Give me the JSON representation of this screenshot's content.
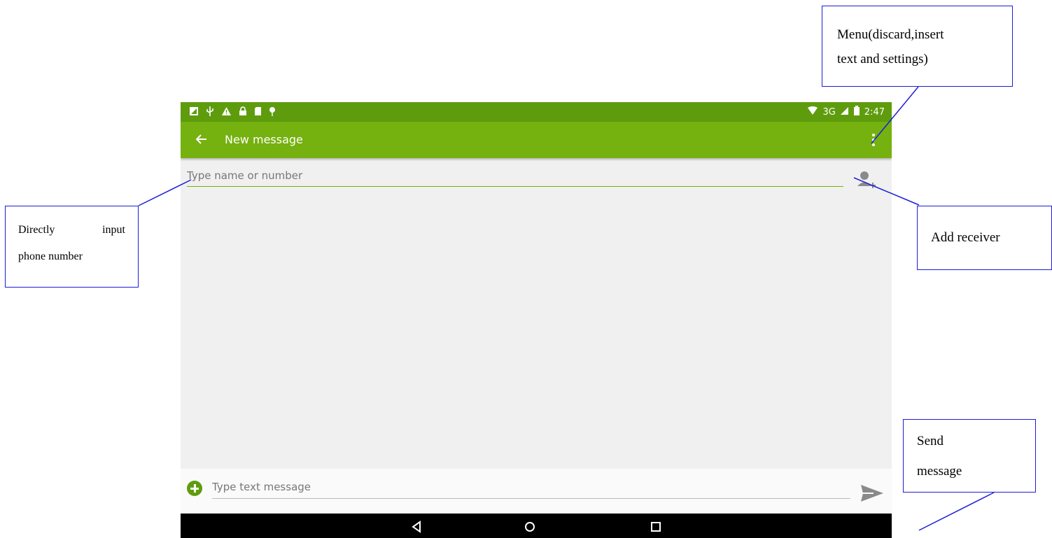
{
  "status_bar": {
    "network": "3G",
    "time": "2:47"
  },
  "app_bar": {
    "back_icon": "arrow-left-icon",
    "title": "New message",
    "menu_icon": "more-vert-icon"
  },
  "recipient": {
    "placeholder": "Type name or number",
    "add_contact_icon": "add-contact-icon"
  },
  "compose": {
    "attach_icon": "plus-circle-icon",
    "placeholder": "Type text message",
    "send_icon": "send-icon"
  },
  "nav_bar": {
    "icons": [
      "back-triangle-icon",
      "home-circle-icon",
      "recents-square-icon"
    ]
  },
  "annotations": {
    "menu_line1": "Menu(discard,insert",
    "menu_line2": "text and settings)",
    "direct_input_word1": "Directly",
    "direct_input_word2": "input",
    "direct_input_line2": "phone number",
    "add_receiver": "Add receiver",
    "send_line1": "Send",
    "send_line2": "message"
  },
  "colors": {
    "status_bar": "#5e9c0e",
    "app_bar": "#75b10f",
    "callout_border": "#1d1dd8"
  }
}
